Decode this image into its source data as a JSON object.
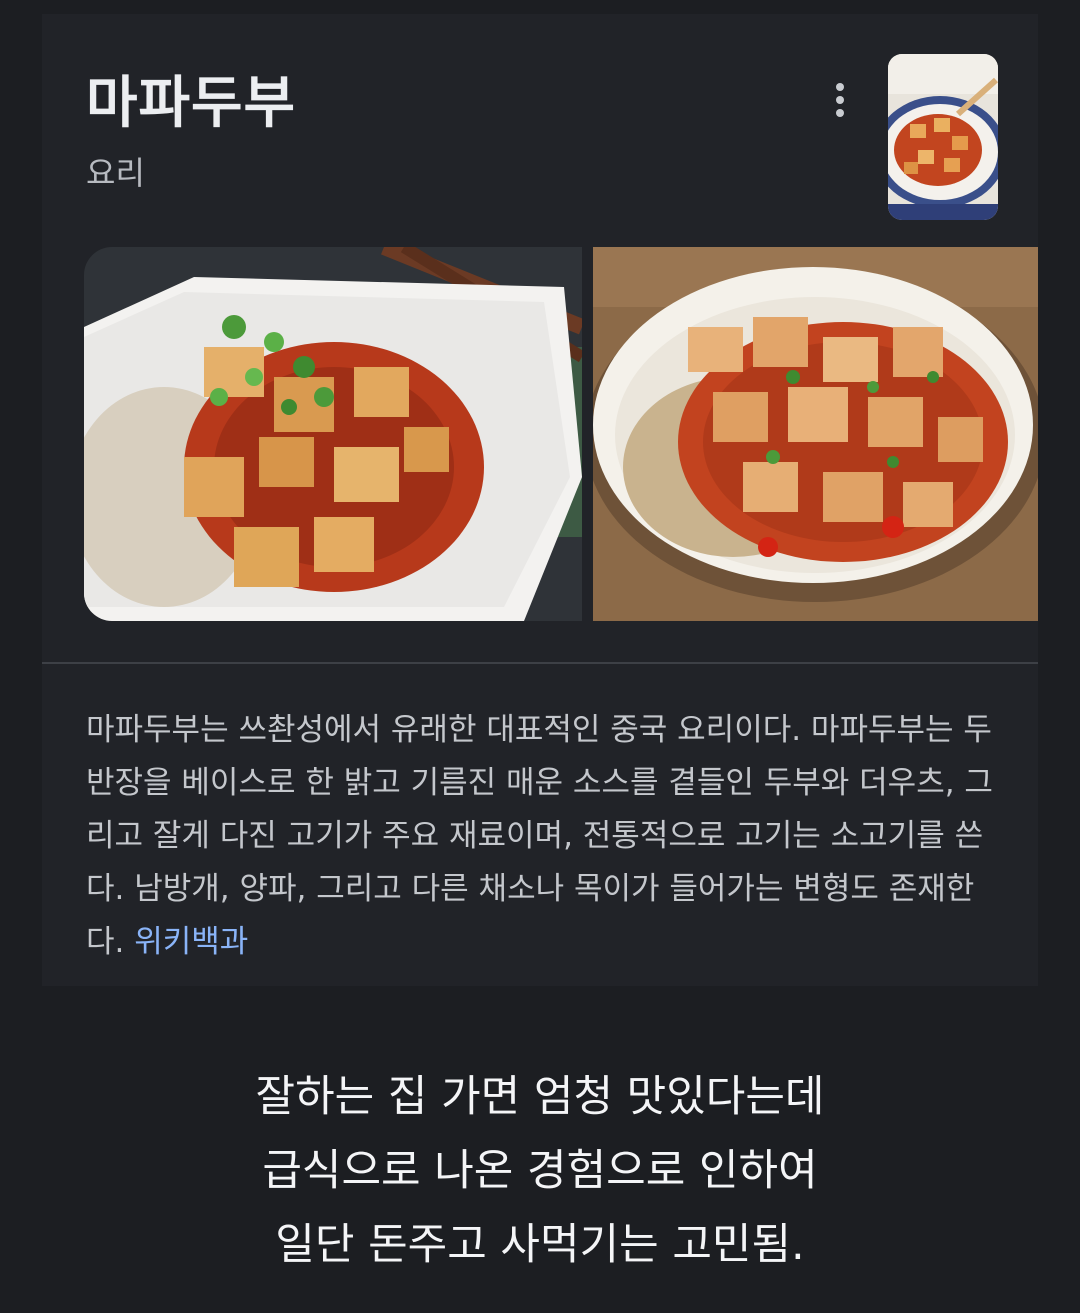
{
  "knowledge_panel": {
    "title": "마파두부",
    "subtitle": "요리",
    "more_options_icon": "more-vert-icon",
    "description": "마파두부는 쓰촨성에서 유래한 대표적인 중국 요리이다. 마파두부는 두반장을 베이스로 한 밝고 기름진 매운 소스를 곁들인 두부와 더우츠, 그리고 잘게 다진 고기가 주요 재료이며, 전통적으로 고기는 소고기를 쓴다. 남방개, 양파, 그리고 다른 채소나 목이가 들어가는 변형도 존재한다.",
    "source_link": "위키백과",
    "link_color": "#8ab4f8"
  },
  "caption": {
    "lines": [
      "잘하는 집 가면 엄청 맛있다는데",
      "급식으로 나온 경험으로 인하여",
      "일단 돈주고 사먹기는 고민됨."
    ]
  }
}
